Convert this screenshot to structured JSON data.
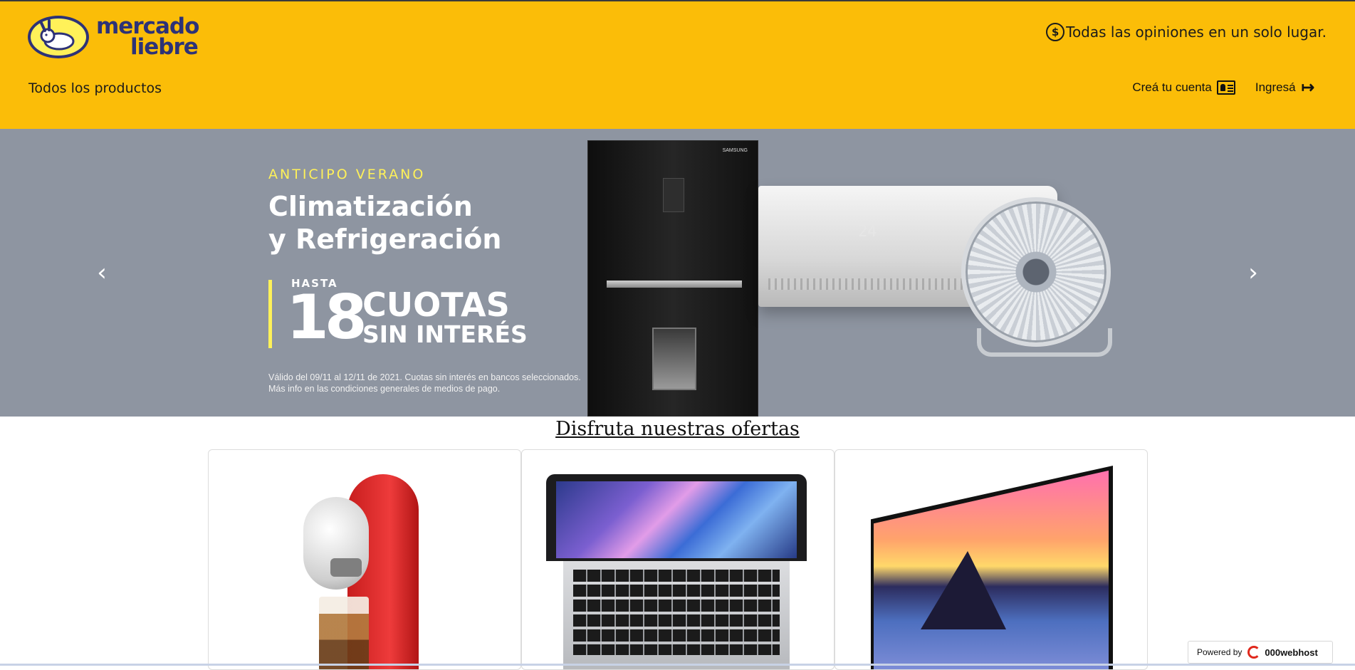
{
  "header": {
    "logo": {
      "line1": "mercado",
      "line2": "liebre"
    },
    "tagline_icon": "$",
    "tagline": "Todas las opiniones en un solo lugar.",
    "all_products": "Todos los productos",
    "create_account": "Creá tu cuenta",
    "login": "Ingresá",
    "login_icon": "↦"
  },
  "banner": {
    "eyebrow": "ANTICIPO VERANO",
    "title_line1": "Climatización",
    "title_line2": "y Refrigeración",
    "promo_hasta": "HASTA",
    "promo_number": "18",
    "promo_cuotas": "CUOTAS",
    "promo_sin": "SIN INTERÉS",
    "legal_line1": "Válido del 09/11 al 12/11 de 2021. Cuotas sin interés en bancos seleccionados.",
    "legal_line2": "Más info en las condiciones generales de medios de pago.",
    "ac_temp": "24",
    "fridge_brand": "SAMSUNG",
    "prev_arrow": "‹",
    "next_arrow": "›"
  },
  "offers": {
    "title": "Disfruta nuestras ofertas",
    "products": [
      "coffee-machine",
      "laptop",
      "television"
    ]
  },
  "footer": {
    "powered_by": "Powered by",
    "host": "000webhost"
  },
  "colors": {
    "header_bg": "#fbbd08",
    "banner_bg": "#8e95a1",
    "logo_navy": "#2d3277",
    "accent_yellow": "#fff159"
  }
}
